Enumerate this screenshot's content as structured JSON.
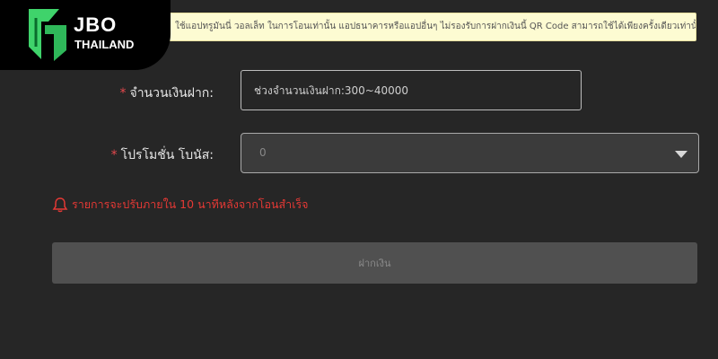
{
  "notice": {
    "text": "ใช้แอปทรูมันนี่ วอลเล็ท ในการโอนเท่านั้น แอปธนาคารหรือแอปอื่นๆ ไม่รองรับการฝากเงินนี้ QR Code สามารถใช้ได้เพียงครั้งเดียวเท่านั้น"
  },
  "logo": {
    "brand": "JBO",
    "region": "THAILAND",
    "icon": "jbo-logo-mark",
    "accent_color": "#3fd36b"
  },
  "form": {
    "required_mark": "*",
    "amount_label": "จำนวนเงินฝาก:",
    "amount_placeholder": "ช่วงจำนวนเงินฝาก:300~40000",
    "promo_label": "โปรโมชั่น โบนัส:",
    "promo_value": "0"
  },
  "warning": {
    "text": "รายการจะปรับภายใน 10 นาทีหลังจากโอนสำเร็จ",
    "icon": "bell-icon",
    "color": "#e53935"
  },
  "submit": {
    "label": "ฝากเงิน"
  }
}
